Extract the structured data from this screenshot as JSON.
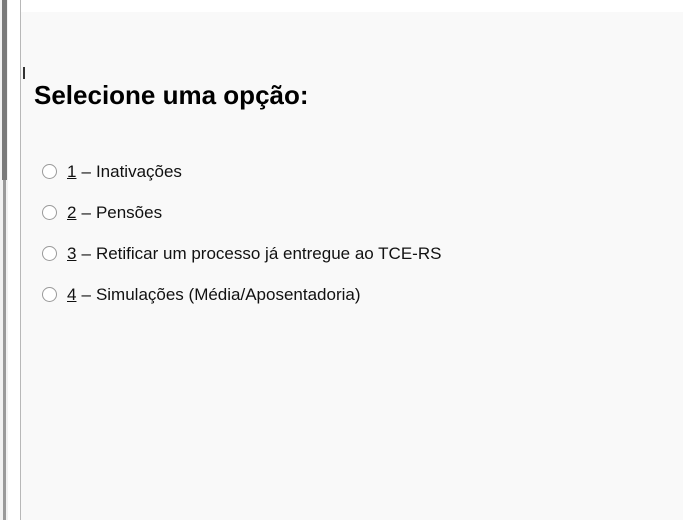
{
  "heading": "Selecione uma opção:",
  "separator": "–",
  "options": [
    {
      "number": "1",
      "label": "Inativações"
    },
    {
      "number": "2",
      "label": "Pensões"
    },
    {
      "number": "3",
      "label": "Retificar um processo já entregue ao TCE-RS"
    },
    {
      "number": "4",
      "label": "Simulações (Média/Aposentadoria)"
    }
  ]
}
